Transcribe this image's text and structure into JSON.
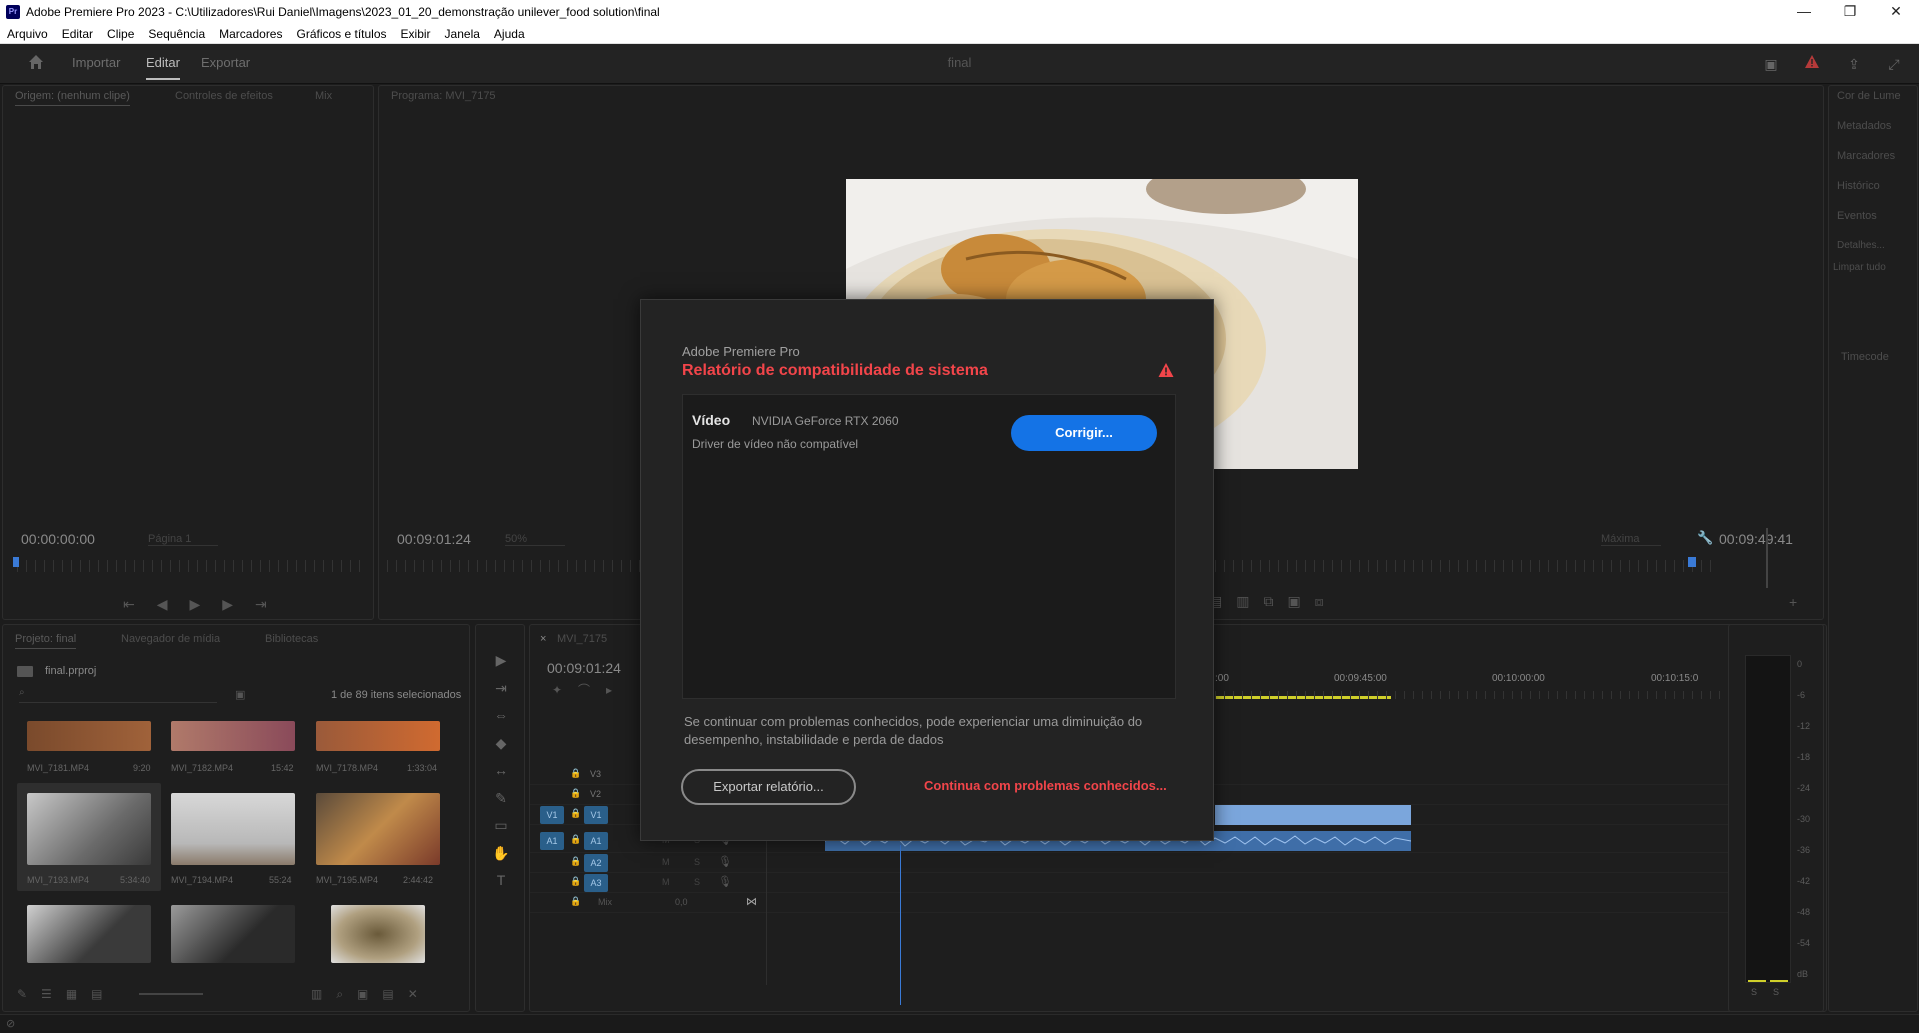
{
  "window": {
    "title": "Adobe Premiere Pro 2023 - C:\\Utilizadores\\Rui Daniel\\Imagens\\2023_01_20_demonstração unilever_food solution\\final",
    "app_icon": "Pr",
    "minimize": "—",
    "maximize": "❐",
    "close": "✕"
  },
  "menu": [
    "Arquivo",
    "Editar",
    "Clipe",
    "Sequência",
    "Marcadores",
    "Gráficos e títulos",
    "Exibir",
    "Janela",
    "Ajuda"
  ],
  "header": {
    "tabs": [
      "Importar",
      "Editar",
      "Exportar"
    ],
    "sequence_name": "final"
  },
  "source_panel": {
    "tabs": [
      "Origem: (nenhum clipe)",
      "Controles de efeitos",
      "Mix"
    ],
    "timecode": "00:00:00:00",
    "zoom": "Página 1"
  },
  "program_panel": {
    "tab": "Programa: MVI_7175",
    "timecode_left": "00:09:01:24",
    "zoom": "50%",
    "quality": "Máxima",
    "timecode_right": "00:09:49:41"
  },
  "right_panel": {
    "items": [
      "Cor de Lume",
      "Metadados",
      "Marcadores",
      "Histórico",
      "Eventos",
      "Detalhes...",
      "Limpar tudo",
      "Timecode"
    ]
  },
  "project_panel": {
    "tabs": [
      "Projeto: final",
      "Navegador de mídia",
      "Bibliotecas"
    ],
    "project_file": "final.prproj",
    "selection_info": "1 de 89 itens selecionados",
    "clips": [
      {
        "name": "MVI_7181.MP4",
        "duration": "9:20"
      },
      {
        "name": "MVI_7182.MP4",
        "duration": "15:42"
      },
      {
        "name": "MVI_7178.MP4",
        "duration": "1:33:04"
      },
      {
        "name": "MVI_7193.MP4",
        "duration": "5:34:40"
      },
      {
        "name": "MVI_7194.MP4",
        "duration": "55:24"
      },
      {
        "name": "MVI_7195.MP4",
        "duration": "2:44:42"
      },
      {
        "name": "",
        "duration": ""
      },
      {
        "name": "",
        "duration": ""
      },
      {
        "name": "",
        "duration": ""
      }
    ]
  },
  "timeline": {
    "tab": "MVI_7175",
    "close": "×",
    "timecode": "00:09:01:24",
    "ruler_labels": [
      ":00",
      "00:09:45:00",
      "00:10:00:00",
      "00:10:15:0"
    ],
    "tracks": [
      "V3",
      "V2",
      "V1",
      "A1",
      "A2",
      "A3"
    ],
    "source_v": "V1",
    "source_a": "A1",
    "mix_label": "Mix",
    "mix_value": "0,0",
    "track_toggles": {
      "mute": "M",
      "solo": "S"
    }
  },
  "meters": {
    "labels": [
      "0",
      "-6",
      "-12",
      "-18",
      "-24",
      "-30",
      "-36",
      "-42",
      "-48",
      "-54",
      "dB"
    ],
    "solo_left": "S",
    "solo_right": "S"
  },
  "dialog": {
    "app_name": "Adobe Premiere Pro",
    "heading": "Relatório de compatibilidade de sistema",
    "category": "Vídeo",
    "gpu": "NVIDIA GeForce RTX 2060",
    "issue": "Driver de vídeo não compatível",
    "fix_button": "Corrigir...",
    "note": "Se continuar com problemas conhecidos, pode experienciar uma diminuição do desempenho, instabilidade e perda de dados",
    "export_button": "Exportar relatório...",
    "continue_link": "Continua com problemas conhecidos...",
    "accent": "#1473e6",
    "alert": "#f2454a"
  }
}
